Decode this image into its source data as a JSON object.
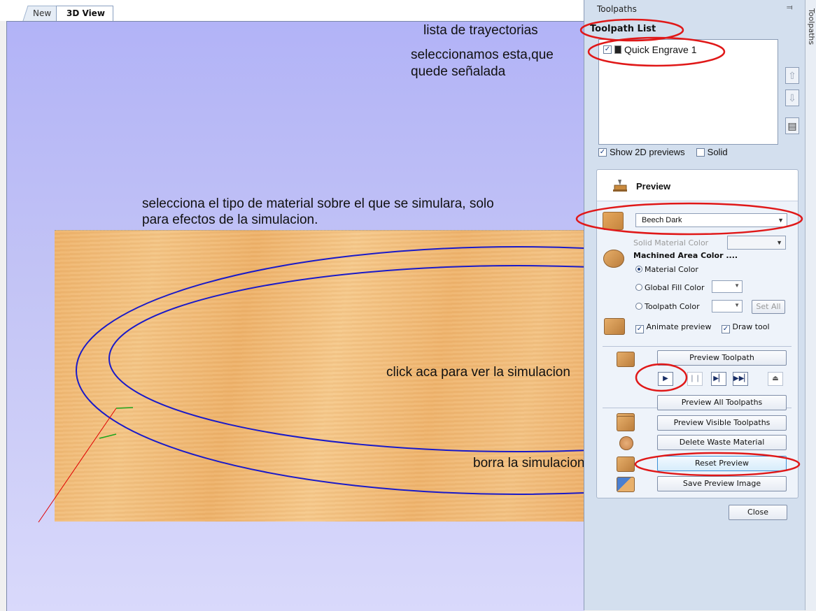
{
  "tabs": [
    {
      "label": "New",
      "active": false
    },
    {
      "label": "3D View",
      "active": true
    }
  ],
  "annotations": {
    "toolpath_list": "lista de trayectorias",
    "select_line1": "seleccionamos esta,que",
    "select_line2": "quede señalada",
    "material_line1": "selecciona el tipo de material sobre el que se simulara, solo",
    "material_line2": "para  efectos de la simulacion.",
    "click_play": "click aca para ver la simulacion",
    "reset": "borra  la simulacion"
  },
  "panel": {
    "title": "Toolpaths",
    "side_tab": "Toolpaths",
    "list_title": "Toolpath List",
    "list_items": [
      {
        "label": "Quick Engrave 1",
        "checked": true
      }
    ],
    "show_2d_label": "Show 2D previews",
    "show_2d_checked": true,
    "solid_label": "Solid",
    "solid_checked": false
  },
  "preview": {
    "title": "Preview",
    "material": "Beech Dark",
    "solid_material_color_label": "Solid Material Color",
    "machined_area_label": "Machined Area Color ....",
    "radio_material": "Material Color",
    "radio_global": "Global Fill Color",
    "radio_toolpath": "Toolpath Color",
    "set_all": "Set All",
    "animate_label": "Animate preview",
    "draw_tool_label": "Draw tool",
    "preview_toolpath": "Preview Toolpath",
    "preview_all": "Preview All Toolpaths",
    "preview_visible": "Preview Visible Toolpaths",
    "delete_waste": "Delete Waste Material",
    "reset_preview": "Reset Preview",
    "save_image": "Save Preview Image",
    "close": "Close"
  },
  "colors": {
    "annotation_ellipse": "#e01818",
    "toolpath_line": "#1a1ac8",
    "axis_x": "#e00000",
    "axis_y": "#1ca51c"
  }
}
